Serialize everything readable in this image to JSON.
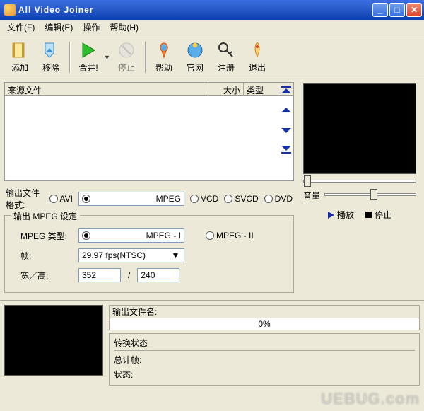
{
  "window": {
    "title": "All Video Joiner"
  },
  "menu": {
    "file": "文件(F)",
    "edit": "编辑(E)",
    "action": "操作",
    "help": "帮助(H)"
  },
  "toolbar": {
    "add": "添加",
    "remove": "移除",
    "merge": "合并!",
    "stop": "停止",
    "help": "帮助",
    "site": "官网",
    "register": "注册",
    "exit": "退出"
  },
  "list": {
    "col_source": "来源文件",
    "col_size": "大小",
    "col_type": "类型"
  },
  "format": {
    "label": "输出文件格式:",
    "options": [
      "AVI",
      "MPEG",
      "VCD",
      "SVCD",
      "DVD"
    ],
    "selected": "MPEG"
  },
  "mpeg": {
    "legend": "输出 MPEG 设定",
    "type_label": "MPEG 类型:",
    "type_opts": [
      "MPEG - I",
      "MPEG - II"
    ],
    "type_selected": "MPEG - I",
    "fps_label": "帧:",
    "fps_value": "29.97 fps(NTSC)",
    "wh_label": "宽／高:",
    "width": "352",
    "height": "240",
    "slash": "/"
  },
  "right": {
    "volume": "音量",
    "play": "播放",
    "stop": "停止"
  },
  "bottom": {
    "outfile_label": "输出文件名:",
    "progress": "0%",
    "status_hdr": "转换状态",
    "total_frames": "总计帧:",
    "status": "状态:"
  },
  "watermark": "UEBUG.com"
}
